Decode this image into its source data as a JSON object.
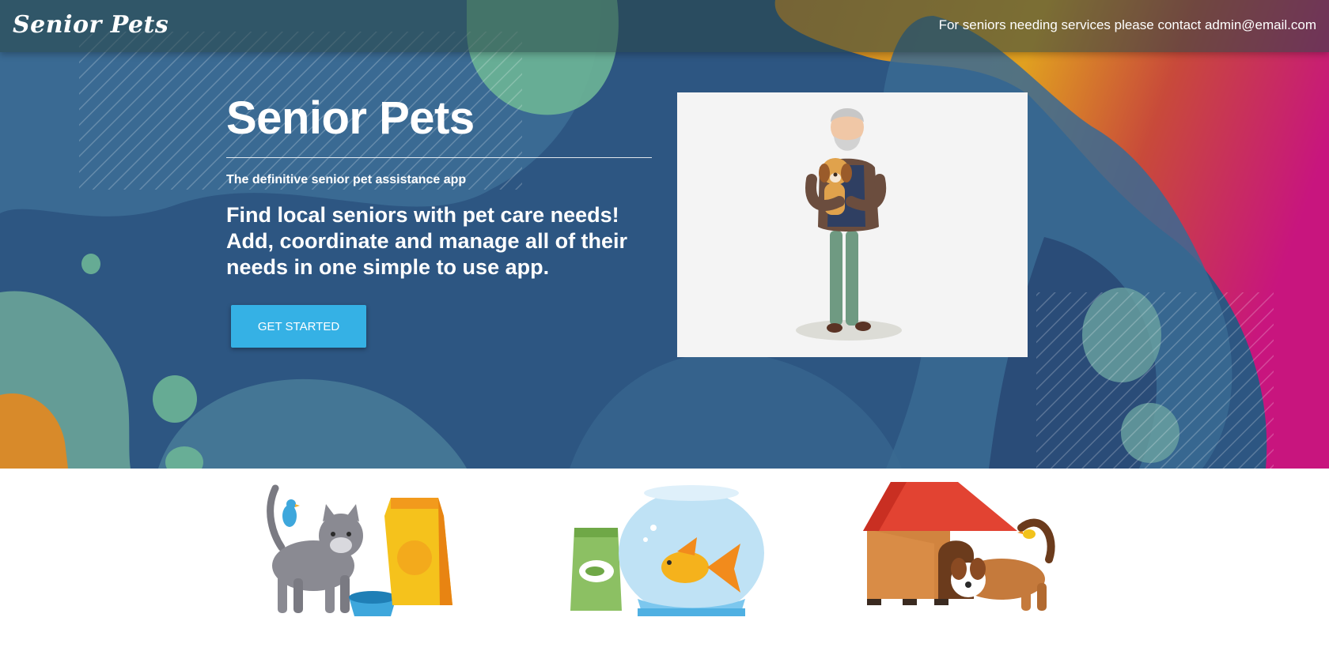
{
  "navbar": {
    "brand": "Senior Pets",
    "contact_text": "For seniors needing services please contact admin@email.com"
  },
  "hero": {
    "title": "Senior Pets",
    "subtitle": "The definitive senior pet assistance app",
    "lead": "Find local seniors with pet care needs! Add, coordinate and manage all of their needs in one simple to use app.",
    "cta_label": "GET STARTED",
    "image_icon": "senior-man-holding-dog-illustration"
  },
  "pets": [
    {
      "icon": "cat-with-bird-and-food-illustration"
    },
    {
      "icon": "goldfish-bowl-and-fish-food-illustration"
    },
    {
      "icon": "dog-with-doghouse-illustration"
    }
  ],
  "colors": {
    "cta": "#35b1e5",
    "hero_base": "#2f5a85",
    "accent_green": "#6db596",
    "accent_orange": "#d88a2a",
    "accent_magenta": "#c81a7c"
  }
}
